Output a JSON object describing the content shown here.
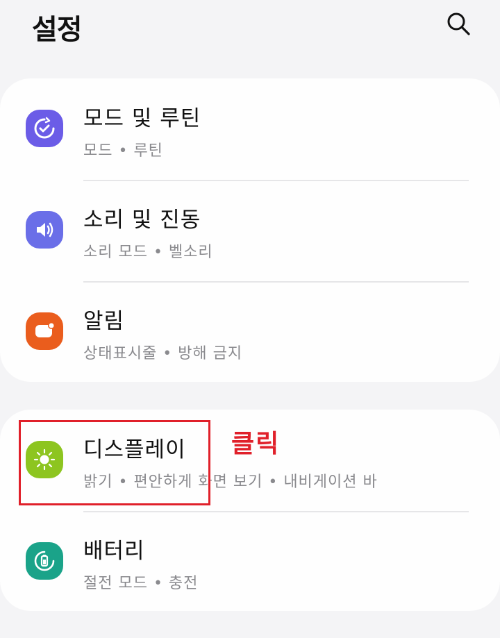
{
  "header": {
    "title": "설정",
    "search_icon": "search-icon"
  },
  "groups": [
    {
      "items": [
        {
          "label": "모드 및 루틴",
          "sub": "모드  •  루틴",
          "icon": "modes-routines-icon",
          "color": "#6b5ce7"
        },
        {
          "label": "소리 및 진동",
          "sub": "소리 모드  •  벨소리",
          "icon": "sound-icon",
          "color": "#6a6ee8"
        },
        {
          "label": "알림",
          "sub": "상태표시줄  •  방해 금지",
          "icon": "notification-icon",
          "color": "#ea5d1d"
        }
      ]
    },
    {
      "items": [
        {
          "label": "디스플레이",
          "sub": "밝기  •  편안하게 화면 보기  •  내비게이션 바",
          "icon": "brightness-icon",
          "color": "#8dc520"
        },
        {
          "label": "배터리",
          "sub": "절전 모드  •  충전",
          "icon": "battery-icon",
          "color": "#1aa389"
        }
      ]
    }
  ],
  "annotation": {
    "text": "클릭",
    "color": "#e0202a"
  }
}
